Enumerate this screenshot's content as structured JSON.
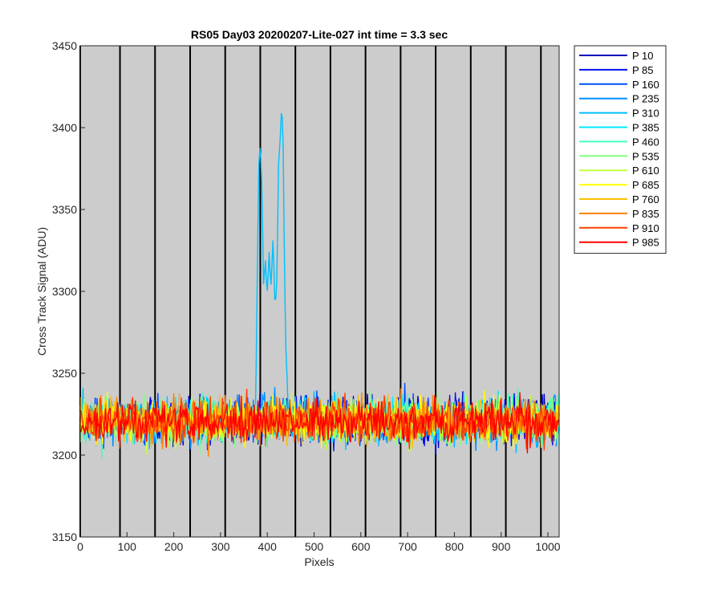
{
  "chart_data": {
    "type": "line",
    "title": "RS05 Day03 20200207-Lite-027 int time = 3.3 sec",
    "xlabel": "Pixels",
    "ylabel": "Cross Track Signal (ADU)",
    "xlim": [
      0,
      1024
    ],
    "ylim": [
      3150,
      3450
    ],
    "xticks": [
      0,
      100,
      200,
      300,
      400,
      500,
      600,
      700,
      800,
      900,
      1000
    ],
    "yticks": [
      3150,
      3200,
      3250,
      3300,
      3350,
      3400,
      3450
    ],
    "background_color": "#cccccc",
    "grid": false,
    "legend_position": "outside-top-right",
    "vertical_markers": [
      0,
      85,
      160,
      235,
      310,
      385,
      460,
      535,
      610,
      685,
      760,
      835,
      910,
      985
    ],
    "noise_band": {
      "mean": 3221,
      "min": 3188,
      "max": 3253
    },
    "series": [
      {
        "name": "P 10",
        "color": "#0000bf"
      },
      {
        "name": "P 85",
        "color": "#0010f0"
      },
      {
        "name": "P 160",
        "color": "#0050ff"
      },
      {
        "name": "P 235",
        "color": "#0090ff"
      },
      {
        "name": "P 310",
        "color": "#00bfff",
        "feature": [
          {
            "x": 375,
            "y": 3225
          },
          {
            "x": 378,
            "y": 3300
          },
          {
            "x": 382,
            "y": 3372
          },
          {
            "x": 385,
            "y": 3390
          },
          {
            "x": 388,
            "y": 3365
          },
          {
            "x": 392,
            "y": 3305
          },
          {
            "x": 396,
            "y": 3318
          },
          {
            "x": 400,
            "y": 3300
          },
          {
            "x": 404,
            "y": 3322
          },
          {
            "x": 408,
            "y": 3302
          },
          {
            "x": 412,
            "y": 3328
          },
          {
            "x": 416,
            "y": 3293
          },
          {
            "x": 420,
            "y": 3300
          },
          {
            "x": 424,
            "y": 3375
          },
          {
            "x": 428,
            "y": 3395
          },
          {
            "x": 431,
            "y": 3414
          },
          {
            "x": 434,
            "y": 3385
          },
          {
            "x": 437,
            "y": 3310
          },
          {
            "x": 440,
            "y": 3262
          },
          {
            "x": 444,
            "y": 3230
          }
        ]
      },
      {
        "name": "P 385",
        "color": "#00e8ff"
      },
      {
        "name": "P 460",
        "color": "#40ffc0"
      },
      {
        "name": "P 535",
        "color": "#80ff80"
      },
      {
        "name": "P 610",
        "color": "#c0ff40"
      },
      {
        "name": "P 685",
        "color": "#ffff00"
      },
      {
        "name": "P 760",
        "color": "#ffc000"
      },
      {
        "name": "P 835",
        "color": "#ff8000"
      },
      {
        "name": "P 910",
        "color": "#ff4000"
      },
      {
        "name": "P 985",
        "color": "#ff0000"
      }
    ]
  }
}
